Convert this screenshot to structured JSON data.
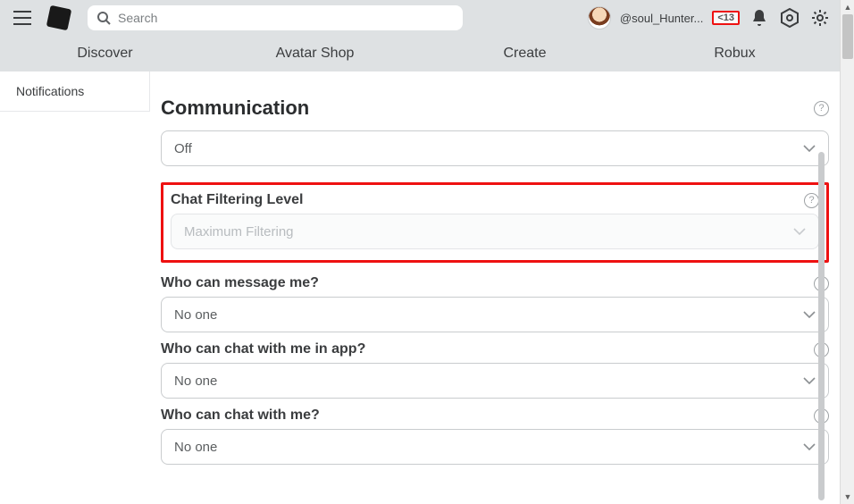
{
  "header": {
    "search_placeholder": "Search",
    "username": "@soul_Hunter...",
    "age_badge": "<13"
  },
  "nav": {
    "items": [
      "Discover",
      "Avatar Shop",
      "Create",
      "Robux"
    ]
  },
  "sidebar": {
    "items": [
      {
        "label": "Notifications"
      }
    ]
  },
  "section": {
    "title": "Communication",
    "settings": [
      {
        "label": "",
        "value": "Off",
        "disabled": false
      },
      {
        "label": "Chat Filtering Level",
        "value": "Maximum Filtering",
        "disabled": true,
        "highlighted": true
      },
      {
        "label": "Who can message me?",
        "value": "No one",
        "disabled": false
      },
      {
        "label": "Who can chat with me in app?",
        "value": "No one",
        "disabled": false
      },
      {
        "label": "Who can chat with me?",
        "value": "No one",
        "disabled": false
      }
    ]
  }
}
